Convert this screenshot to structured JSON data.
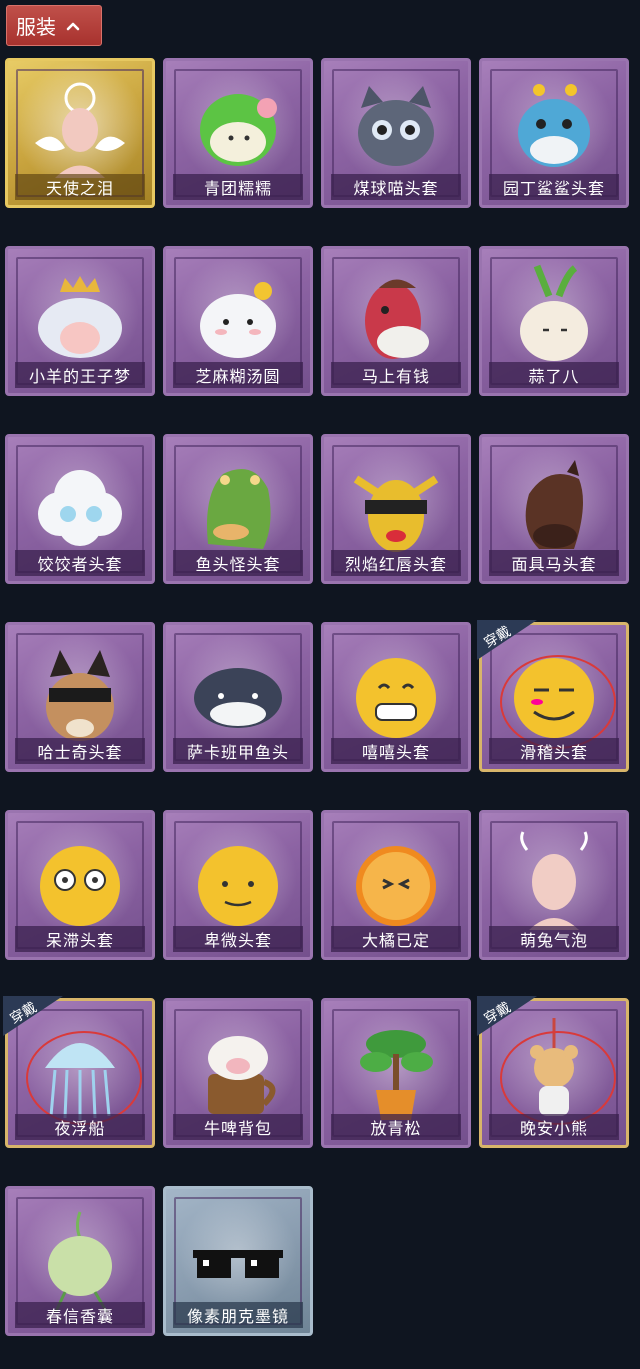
{
  "header": {
    "title": "服装",
    "toggle_icon": "chevron-up-icon"
  },
  "badge_text": "穿戴",
  "items": [
    {
      "name": "天使之泪",
      "icon": "angel-wings-icon",
      "frame": "gold",
      "equipped": false
    },
    {
      "name": "青团糯糯",
      "icon": "green-dumpling-icon",
      "frame": "purple",
      "equipped": false
    },
    {
      "name": "煤球喵头套",
      "icon": "grey-cat-head-icon",
      "frame": "purple",
      "equipped": false
    },
    {
      "name": "园丁鲨鲨头套",
      "icon": "blue-shark-head-icon",
      "frame": "purple",
      "equipped": false
    },
    {
      "name": "小羊的王子梦",
      "icon": "sheep-crown-icon",
      "frame": "purple",
      "equipped": false
    },
    {
      "name": "芝麻糊汤圆",
      "icon": "rice-ball-icon",
      "frame": "purple",
      "equipped": false
    },
    {
      "name": "马上有钱",
      "icon": "red-horse-head-icon",
      "frame": "purple",
      "equipped": false
    },
    {
      "name": "蒜了八",
      "icon": "garlic-icon",
      "frame": "purple",
      "equipped": false
    },
    {
      "name": "饺饺者头套",
      "icon": "cloud-dumpling-icon",
      "frame": "purple",
      "equipped": false
    },
    {
      "name": "鱼头怪头套",
      "icon": "fish-head-icon",
      "frame": "purple",
      "equipped": false
    },
    {
      "name": "烈焰红唇头套",
      "icon": "yellow-mask-icon",
      "frame": "purple",
      "equipped": false
    },
    {
      "name": "面具马头套",
      "icon": "horse-mask-icon",
      "frame": "purple",
      "equipped": false
    },
    {
      "name": "哈士奇头套",
      "icon": "husky-head-icon",
      "frame": "purple",
      "equipped": false
    },
    {
      "name": "萨卡班甲鱼头",
      "icon": "fish-blob-icon",
      "frame": "purple",
      "equipped": false
    },
    {
      "name": "嘻嘻头套",
      "icon": "grin-emoji-icon",
      "frame": "purple",
      "equipped": false
    },
    {
      "name": "滑稽头套",
      "icon": "smirk-emoji-icon",
      "frame": "purple",
      "equipped": true
    },
    {
      "name": "呆滞头套",
      "icon": "stare-emoji-icon",
      "frame": "purple",
      "equipped": false
    },
    {
      "name": "卑微头套",
      "icon": "humble-emoji-icon",
      "frame": "purple",
      "equipped": false
    },
    {
      "name": "大橘已定",
      "icon": "orange-slice-icon",
      "frame": "purple",
      "equipped": false
    },
    {
      "name": "萌兔气泡",
      "icon": "bunny-bubble-icon",
      "frame": "purple",
      "equipped": false
    },
    {
      "name": "夜浮船",
      "icon": "jellyfish-icon",
      "frame": "purple",
      "equipped": true
    },
    {
      "name": "牛啤背包",
      "icon": "cow-beer-mug-icon",
      "frame": "purple",
      "equipped": false
    },
    {
      "name": "放青松",
      "icon": "bonsai-pine-icon",
      "frame": "purple",
      "equipped": false
    },
    {
      "name": "晚安小熊",
      "icon": "teddy-bear-icon",
      "frame": "purple",
      "equipped": true
    },
    {
      "name": "春信香囊",
      "icon": "sachet-pouch-icon",
      "frame": "purple",
      "equipped": false
    },
    {
      "name": "像素朋克墨镜",
      "icon": "pixel-sunglasses-icon",
      "frame": "blue",
      "equipped": false
    }
  ]
}
